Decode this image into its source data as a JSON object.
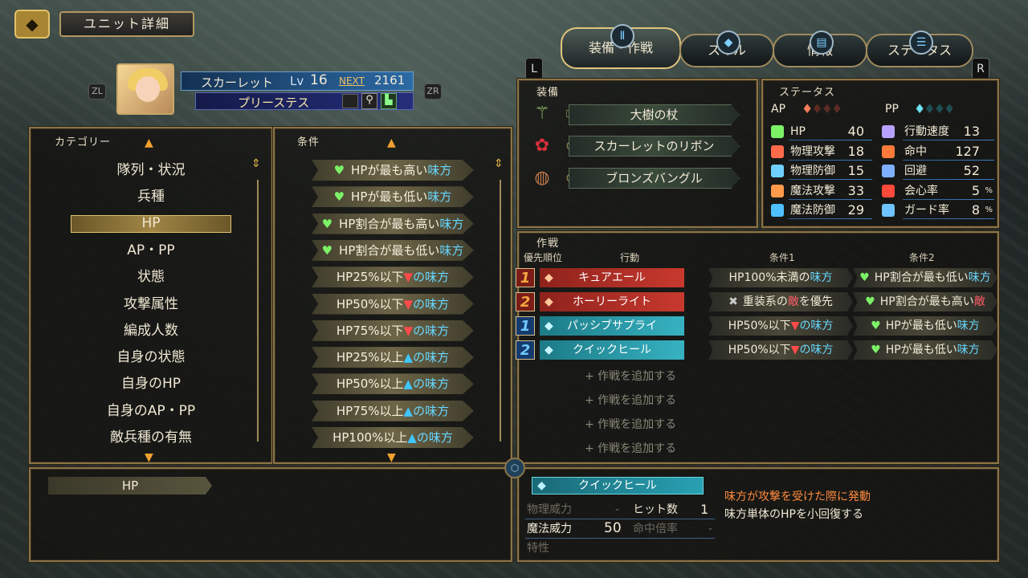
{
  "header": {
    "title": "ユニット詳細"
  },
  "tabs": [
    {
      "label": "装備・作戦",
      "active": true
    },
    {
      "label": "スキル"
    },
    {
      "label": "情報"
    },
    {
      "label": "ステータス"
    }
  ],
  "shoulder": {
    "left": "L",
    "right": "R",
    "zl": "ZL",
    "zr": "ZR"
  },
  "unit": {
    "name": "スカーレット",
    "lv_label": "Lv",
    "lv": "16",
    "next_label": "NEXT",
    "next": "2161",
    "class": "プリーステス"
  },
  "category": {
    "title": "カテゴリー",
    "items": [
      "隊列・状況",
      "兵種",
      "HP",
      "AP・PP",
      "状態",
      "攻撃属性",
      "編成人数",
      "自身の状態",
      "自身のHP",
      "自身のAP・PP",
      "敵兵種の有無"
    ],
    "selected_index": 2
  },
  "conditions": {
    "title": "条件",
    "items": [
      {
        "pre": "",
        "main": "HPが最も高い",
        "tail": "味方",
        "tail_type": "ally",
        "heart": true
      },
      {
        "pre": "",
        "main": "HPが最も低い",
        "tail": "味方",
        "tail_type": "ally",
        "heart": true
      },
      {
        "pre": "",
        "main": "HP割合が最も高い",
        "tail": "味方",
        "tail_type": "ally",
        "heart": true
      },
      {
        "pre": "",
        "main": "HP割合が最も低い",
        "tail": "味方",
        "tail_type": "ally",
        "heart": true
      },
      {
        "main": "HP25%以下",
        "mark": "▼",
        "tail": "の味方",
        "tail_type": "ally"
      },
      {
        "main": "HP50%以下",
        "mark": "▼",
        "tail": "の味方",
        "tail_type": "ally"
      },
      {
        "main": "HP75%以下",
        "mark": "▼",
        "tail": "の味方",
        "tail_type": "ally"
      },
      {
        "main": "HP25%以上",
        "mark": "▲",
        "tail": "の味方",
        "tail_type": "ally"
      },
      {
        "main": "HP50%以上",
        "mark": "▲",
        "tail": "の味方",
        "tail_type": "ally"
      },
      {
        "main": "HP75%以上",
        "mark": "▲",
        "tail": "の味方",
        "tail_type": "ally"
      },
      {
        "main": "HP100%以上",
        "mark": "▲",
        "tail": "の味方",
        "tail_type": "ally"
      }
    ]
  },
  "equipment": {
    "title": "装備",
    "items": [
      "大樹の杖",
      "スカーレットのリボン",
      "ブロンズバングル"
    ]
  },
  "status": {
    "title": "ステータス",
    "ap_label": "AP",
    "pp_label": "PP",
    "left": [
      {
        "label": "HP",
        "value": "40"
      },
      {
        "label": "物理攻撃",
        "value": "18"
      },
      {
        "label": "物理防御",
        "value": "15"
      },
      {
        "label": "魔法攻撃",
        "value": "33"
      },
      {
        "label": "魔法防御",
        "value": "29"
      }
    ],
    "right": [
      {
        "label": "行動速度",
        "value": "13",
        "unit": ""
      },
      {
        "label": "命中",
        "value": "127",
        "unit": ""
      },
      {
        "label": "回避",
        "value": "52",
        "unit": ""
      },
      {
        "label": "会心率",
        "value": "5",
        "unit": "%"
      },
      {
        "label": "ガード率",
        "value": "8",
        "unit": "%"
      }
    ]
  },
  "tactics": {
    "title": "作戦",
    "headers": {
      "priority": "優先順位",
      "action": "行動",
      "cond1": "条件1",
      "cond2": "条件2"
    },
    "rows": [
      {
        "prio": "1",
        "type": "ap",
        "action": "キュアエール",
        "cond1": "HP100%未満の",
        "cond1_tail": "味方",
        "cond2": "HP割合が最も低い",
        "cond2_tail": "味方",
        "cond2_tail_type": "ally"
      },
      {
        "prio": "2",
        "type": "ap",
        "action": "ホーリーライト",
        "cond1": "重装系の",
        "cond1_mid": "敵",
        "cond1_tail": "を優先",
        "cond2": "HP割合が最も高い",
        "cond2_tail": "敵",
        "cond2_tail_type": "enemy"
      },
      {
        "prio": "1",
        "type": "pp",
        "action": "パッシブサプライ",
        "cond1": "HP50%以下",
        "cond1_tail": "の味方",
        "cond2": "HPが最も低い",
        "cond2_tail": "味方",
        "cond2_tail_type": "ally"
      },
      {
        "prio": "2",
        "type": "pp",
        "action": "クイックヒール",
        "cond1": "HP50%以下",
        "cond1_tail": "の味方",
        "cond2": "HPが最も低い",
        "cond2_tail": "味方",
        "cond2_tail_type": "ally"
      }
    ],
    "add_label": "+ 作戦を追加する"
  },
  "detail": {
    "selected": "HP"
  },
  "skill": {
    "name": "クイックヒール",
    "trigger": "味方が攻撃を受けた際に発動",
    "desc": "味方単体のHPを小回復する",
    "phys_power_label": "物理威力",
    "phys_power": "-",
    "hits_label": "ヒット数",
    "hits": "1",
    "mag_power_label": "魔法威力",
    "mag_power": "50",
    "hit_mult_label": "命中倍率",
    "hit_mult": "-",
    "trait_label": "特性"
  },
  "colors": {
    "frame": "#8b7448",
    "ally": "#67d7ff",
    "enemy": "#ff5c66",
    "ap_action": "#b8332b",
    "pp_action": "#2b9aa8"
  }
}
